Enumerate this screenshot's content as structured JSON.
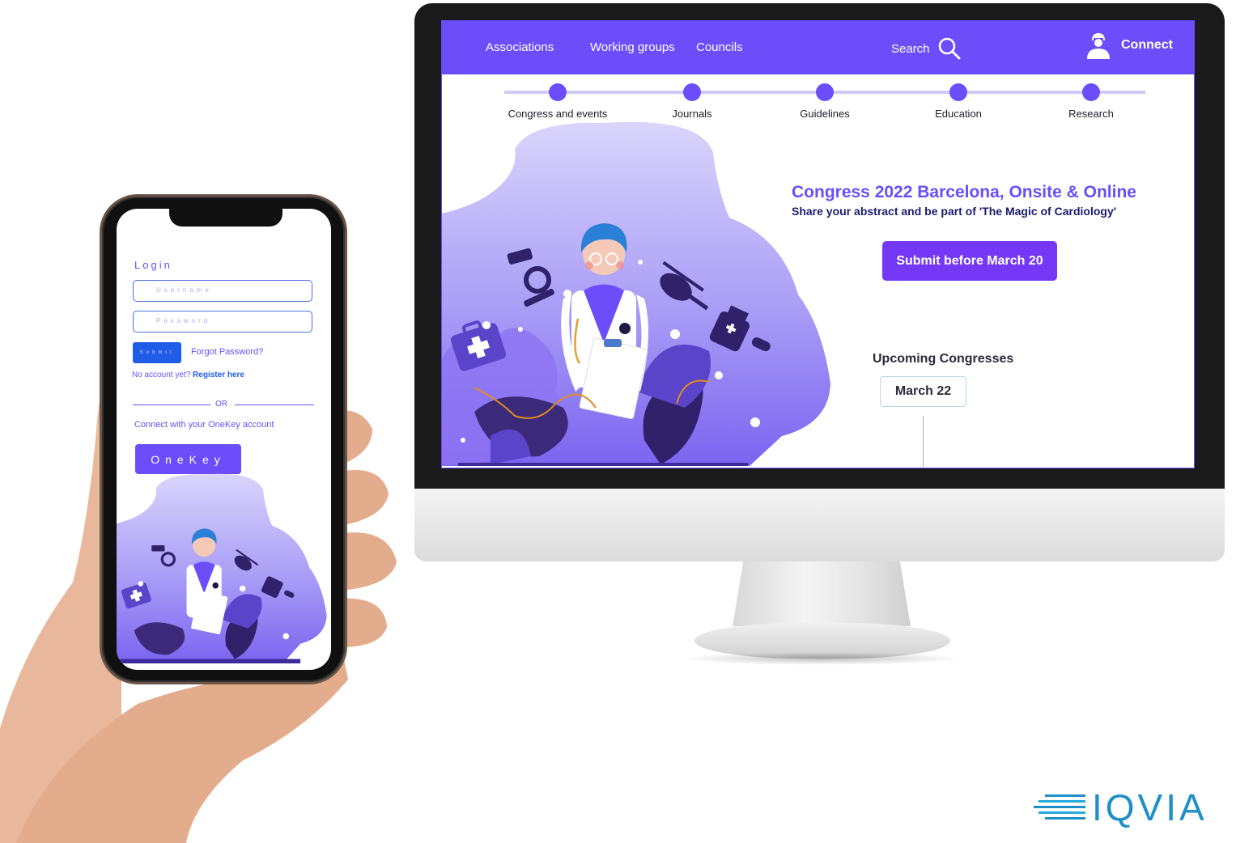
{
  "desktop": {
    "nav": {
      "associations": "Associations",
      "working_groups": "Working groups",
      "councils": "Councils",
      "search": "Search",
      "connect": "Connect"
    },
    "steps": [
      {
        "label": "Congress and events"
      },
      {
        "label": "Journals"
      },
      {
        "label": "Guidelines"
      },
      {
        "label": "Education"
      },
      {
        "label": "Research"
      }
    ],
    "hero": {
      "title": "Congress 2022 Barcelona, Onsite & Online",
      "subtitle": "Share your abstract and be part of 'The Magic of Cardiology'",
      "cta": "Submit before March 20"
    },
    "upcoming": {
      "title": "Upcoming Congresses",
      "date": "March 22"
    },
    "colors": {
      "primary": "#6b4dfa",
      "cta": "#7438f6",
      "title_dark": "#1c1a6e"
    }
  },
  "mobile": {
    "login_title": "Login",
    "username_placeholder": "Username",
    "password_placeholder": "Password",
    "submit": "Submit",
    "forgot": "Forgot Password?",
    "no_account": "No account yet?",
    "register": "Register here",
    "or": "OR",
    "connect_text": "Connect with your OneKey account",
    "onekey": "OneKey"
  },
  "brand": {
    "logo_text": "IQVIA",
    "logo_color": "#1e8fc7"
  },
  "icons": [
    "search-icon",
    "user-icon",
    "doctor-illustration",
    "microscope-icon",
    "helicopter-icon",
    "medical-kit-icon",
    "medicine-bottle-icon",
    "iqvia-logo-icon"
  ]
}
